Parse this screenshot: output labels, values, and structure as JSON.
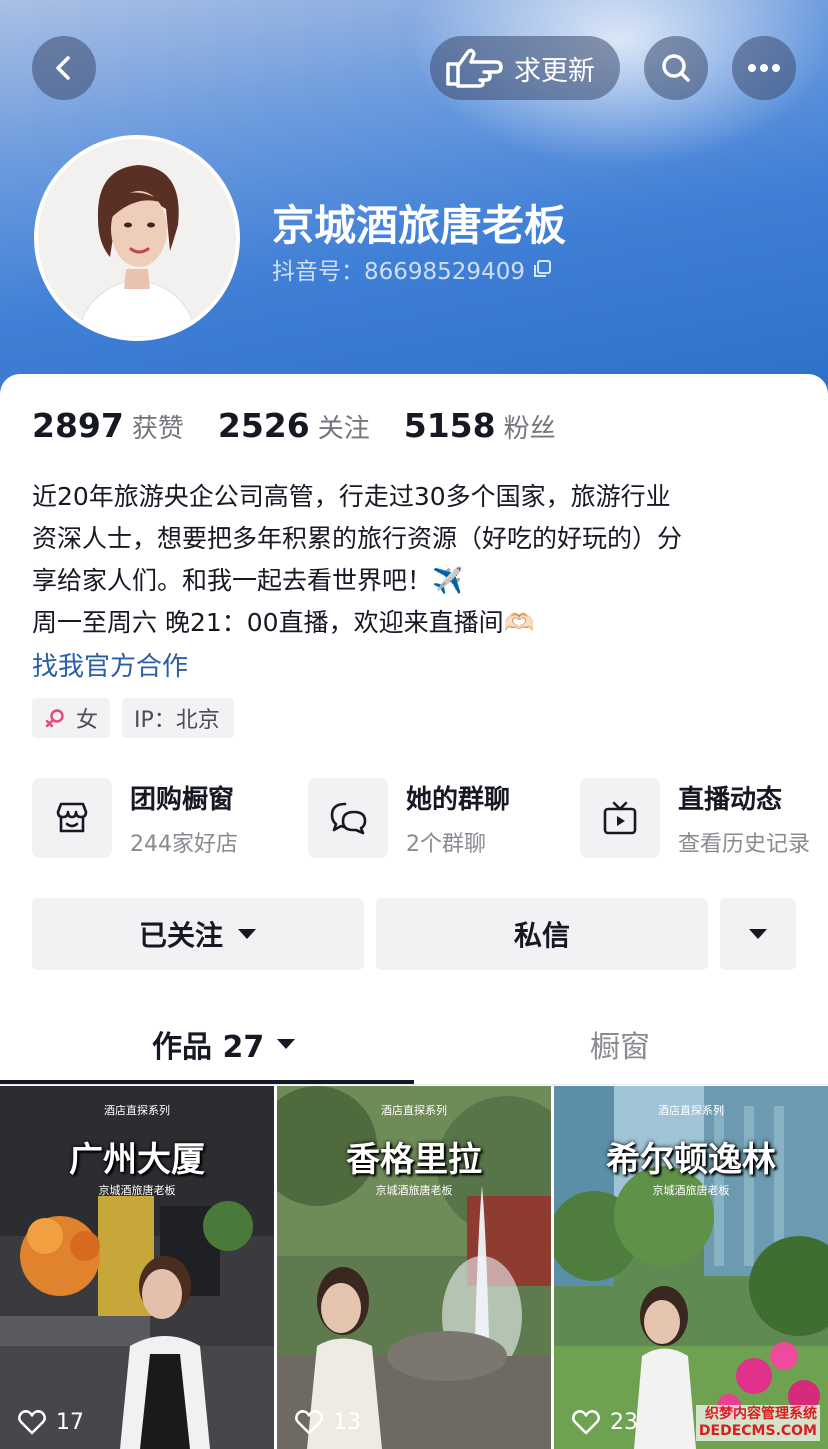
{
  "header": {
    "request_update_label": "求更新",
    "nickname": "京城酒旅唐老板",
    "douyin_id": "抖音号：86698529409"
  },
  "stats": [
    {
      "value": "2897",
      "label": "获赞"
    },
    {
      "value": "2526",
      "label": "关注"
    },
    {
      "value": "5158",
      "label": "粉丝"
    }
  ],
  "bio": {
    "lines": [
      "近20年旅游央企公司高管，行走过30多个国家，旅游行业",
      "资深人士，想要把多年积累的旅行资源（好吃的好玩的）分",
      "享给家人们。和我一起去看世界吧！✈️",
      "周一至周六 晚21：00直播，欢迎来直播间🫶🏻"
    ],
    "link": "找我官方合作"
  },
  "tags": {
    "gender": "女",
    "ip": "IP：北京"
  },
  "features": [
    {
      "title": "团购橱窗",
      "subtitle": "244家好店",
      "icon": "store-icon"
    },
    {
      "title": "她的群聊",
      "subtitle": "2个群聊",
      "icon": "chat-bubbles-icon"
    },
    {
      "title": "直播动态",
      "subtitle": "查看历史记录",
      "icon": "tv-play-icon"
    }
  ],
  "actions": {
    "follow": "已关注",
    "message": "私信"
  },
  "tabs": {
    "works": "作品 27",
    "showcase": "橱窗"
  },
  "videos": [
    {
      "series": "酒店直探系列",
      "title": "广州大厦",
      "subtitle": "京城酒旅唐老板",
      "likes": "17"
    },
    {
      "series": "酒店直探系列",
      "title": "香格里拉",
      "subtitle": "京城酒旅唐老板",
      "likes": "13"
    },
    {
      "series": "酒店直探系列",
      "title": "希尔顿逸林",
      "subtitle": "京城酒旅唐老板",
      "likes": "23"
    }
  ],
  "watermark": {
    "line1": "织梦内容管理系统",
    "line2": "DEDECMS.COM"
  },
  "colors": {
    "header_blue": "#3f7fd6",
    "link_blue": "#2a5ea8",
    "gender_pink": "#e8467c"
  }
}
